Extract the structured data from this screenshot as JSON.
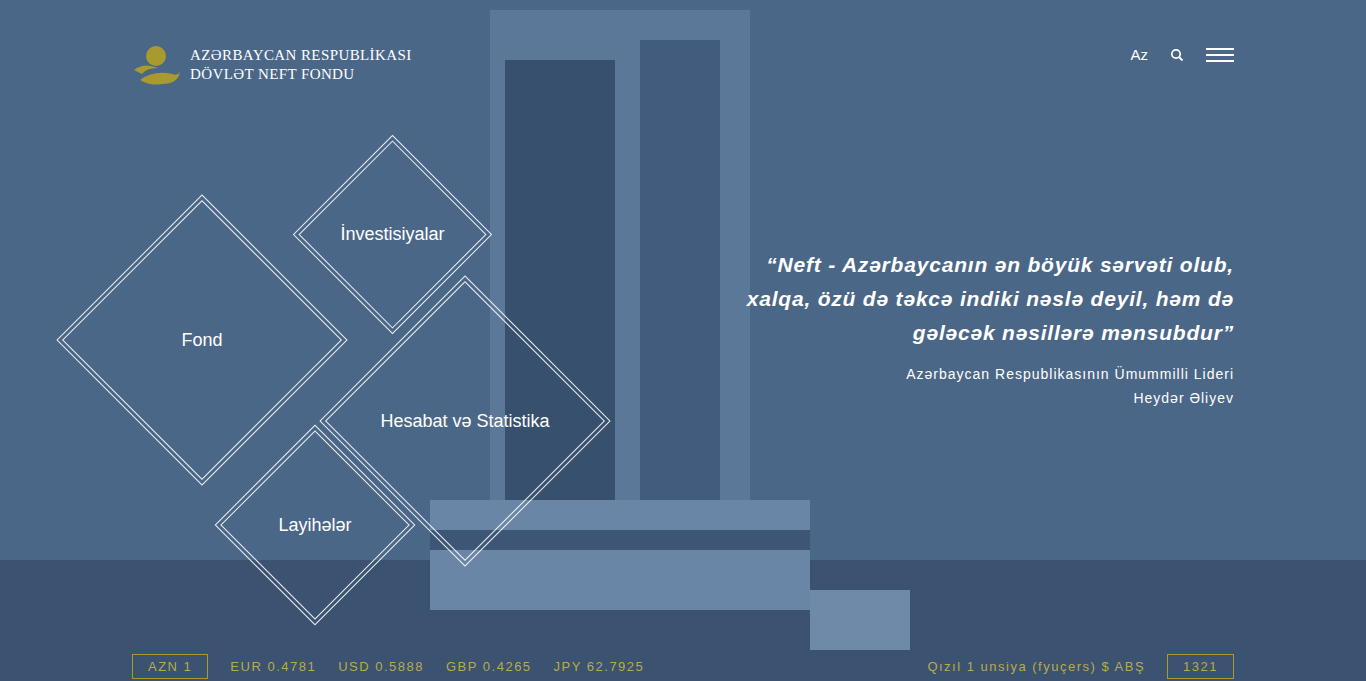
{
  "header": {
    "logo_lines": [
      "AZƏRBAYCAN RESPUBLİKASI",
      "DÖVLƏT NEFT FONDU"
    ],
    "language": "Az"
  },
  "menu_tiles": [
    {
      "label": "Fond"
    },
    {
      "label": "İnvestisiyalar"
    },
    {
      "label": "Hesabat və Statistika"
    },
    {
      "label": "Layihələr"
    }
  ],
  "quote": {
    "lines": [
      "“Neft - Azərbaycanın ən böyük sərvəti olub,",
      "xalqa, özü də təkcə indiki nəslə deyil, həm də",
      "gələcək nəsillərə mənsubdur”"
    ],
    "author_title": "Azərbaycan Respublikasının Ümummilli Lideri",
    "author_name": "Heydər Əliyev"
  },
  "rates": [
    {
      "label": "AZN 1",
      "selected": true
    },
    {
      "label": "EUR 0.4781",
      "selected": false
    },
    {
      "label": "USD 0.5888",
      "selected": false
    },
    {
      "label": "GBP 0.4265",
      "selected": false
    },
    {
      "label": "JPY 62.7925",
      "selected": false
    }
  ],
  "gold": {
    "label": "Qızıl 1 unsiya (fyuçers) $ ABŞ",
    "value": "1321"
  }
}
